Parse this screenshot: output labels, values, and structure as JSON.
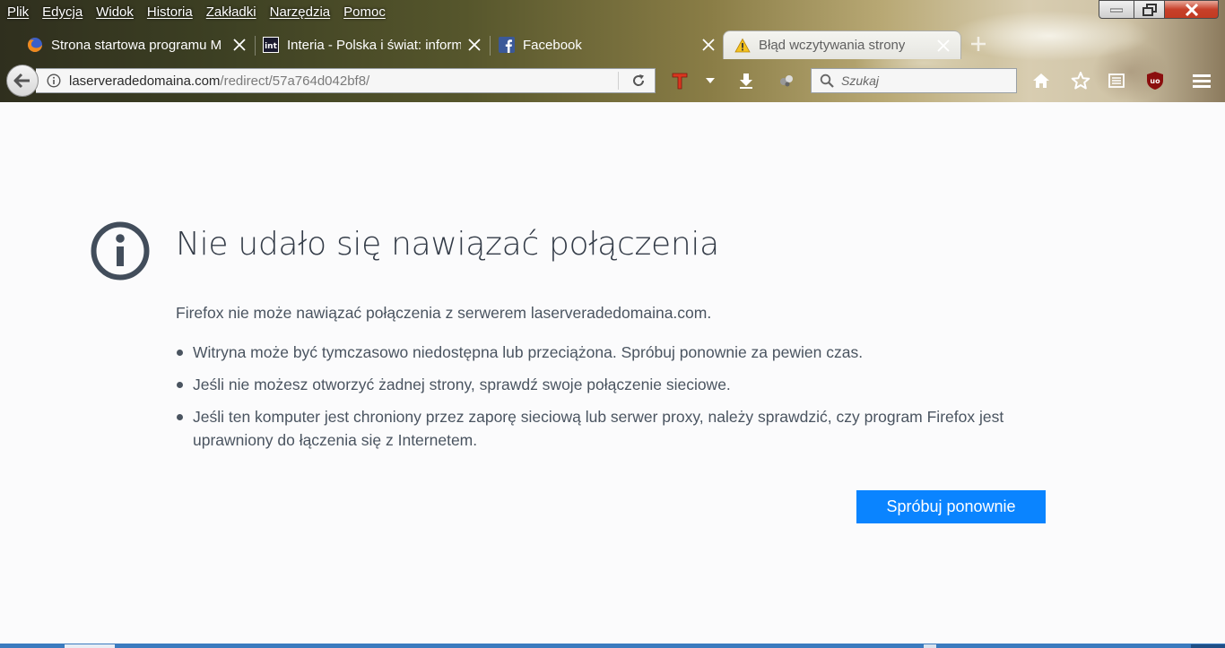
{
  "menubar": {
    "items": [
      "Plik",
      "Edycja",
      "Widok",
      "Historia",
      "Zakładki",
      "Narzędzia",
      "Pomoc"
    ]
  },
  "tabs": [
    {
      "title": "Strona startowa programu M",
      "favicon": "firefox-icon",
      "active": false
    },
    {
      "title": "Interia - Polska i świat: inform",
      "favicon": "interia-icon",
      "active": false
    },
    {
      "title": "Facebook",
      "favicon": "facebook-icon",
      "active": false
    },
    {
      "title": "Błąd wczytywania strony",
      "favicon": "warning-icon",
      "active": true
    }
  ],
  "urlbar": {
    "host": "laserveradedomaina.com",
    "path": "/redirect/57a764d042bf8/"
  },
  "search": {
    "placeholder": "Szukaj"
  },
  "toolbar_icons": [
    "t-addon-icon",
    "dropdown-icon",
    "download-icon",
    "extension-icon",
    "home-icon",
    "bookmark-star-icon",
    "reading-list-icon",
    "ublock-icon",
    "hamburger-menu-icon"
  ],
  "error": {
    "title": "Nie udało się nawiązać połączenia",
    "description": "Firefox nie może nawiązać połączenia z serwerem laserveradedomaina.com.",
    "bullets": [
      "Witryna może być tymczasowo niedostępna lub przeciążona. Spróbuj ponownie za pewien czas.",
      "Jeśli nie możesz otworzyć żadnej strony, sprawdź swoje połączenie sieciowe.",
      "Jeśli ten komputer jest chroniony przez zaporę sieciową lub serwer proxy, należy sprawdzić, czy program Firefox jest uprawniony do łączenia się z Internetem."
    ],
    "retry_label": "Spróbuj ponownie"
  },
  "colors": {
    "accent": "#0a84ff",
    "title_text": "#333b47",
    "body_text": "#4a5460"
  }
}
